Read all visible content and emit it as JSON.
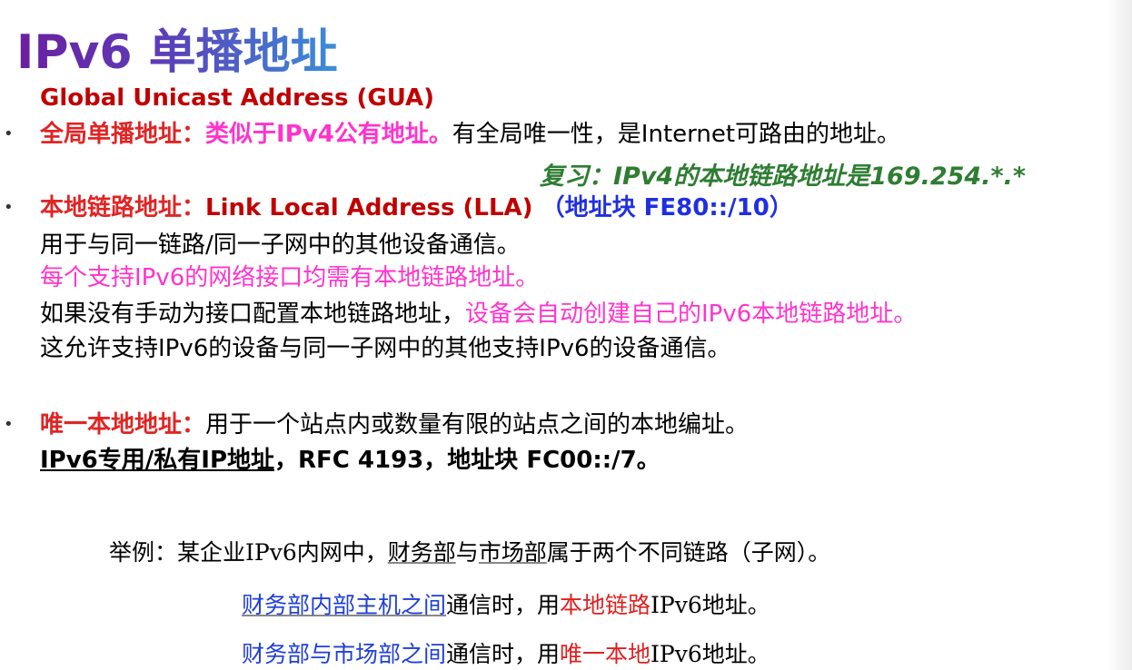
{
  "title": "IPv6 单播地址",
  "gua_label": "Global Unicast Address (GUA)",
  "gua": {
    "term": "全局单播地址：",
    "similar": "类似于IPv4公有地址。",
    "desc": "有全局唯一性，是Internet可路由的地址。"
  },
  "review_note": "复习：IPv4的本地链路地址是169.254.*.*",
  "lla": {
    "term": "本地链路地址：",
    "english": "Link Local Address (LLA)",
    "block": "（地址块 FE80::/10）",
    "line1": "用于与同一链路/同一子网中的其他设备通信。",
    "line2": "每个支持IPv6的网络接口均需有本地链路地址。",
    "line3a": "如果没有手动为接口配置本地链路地址，",
    "line3b": "设备会自动创建自己的IPv6本地链路地址。",
    "line4": "这允许支持IPv6的设备与同一子网中的其他支持IPv6的设备通信。"
  },
  "ula": {
    "term": "唯一本地地址：",
    "desc": "用于一个站点内或数量有限的站点之间的本地编址。",
    "private": "IPv6专用/私有IP地址",
    "rest": "，RFC 4193，地址块 FC00::/7。"
  },
  "example": {
    "prefix": "举例：某企业IPv6内网中，",
    "finance": "财务部",
    "and": "与",
    "market": "市场部",
    "suffix": "属于两个不同链路（子网）。",
    "line2_blue": "财务部内部主机之间",
    "line2_mid": "通信时，用",
    "line2_red": "本地链路",
    "line2_end": "IPv6地址。",
    "line3_blue": "财务部与市场部之间",
    "line3_mid": "通信时，用",
    "line3_red": "唯一本地",
    "line3_end": "IPv6地址。"
  },
  "bullet_symbol": "•"
}
